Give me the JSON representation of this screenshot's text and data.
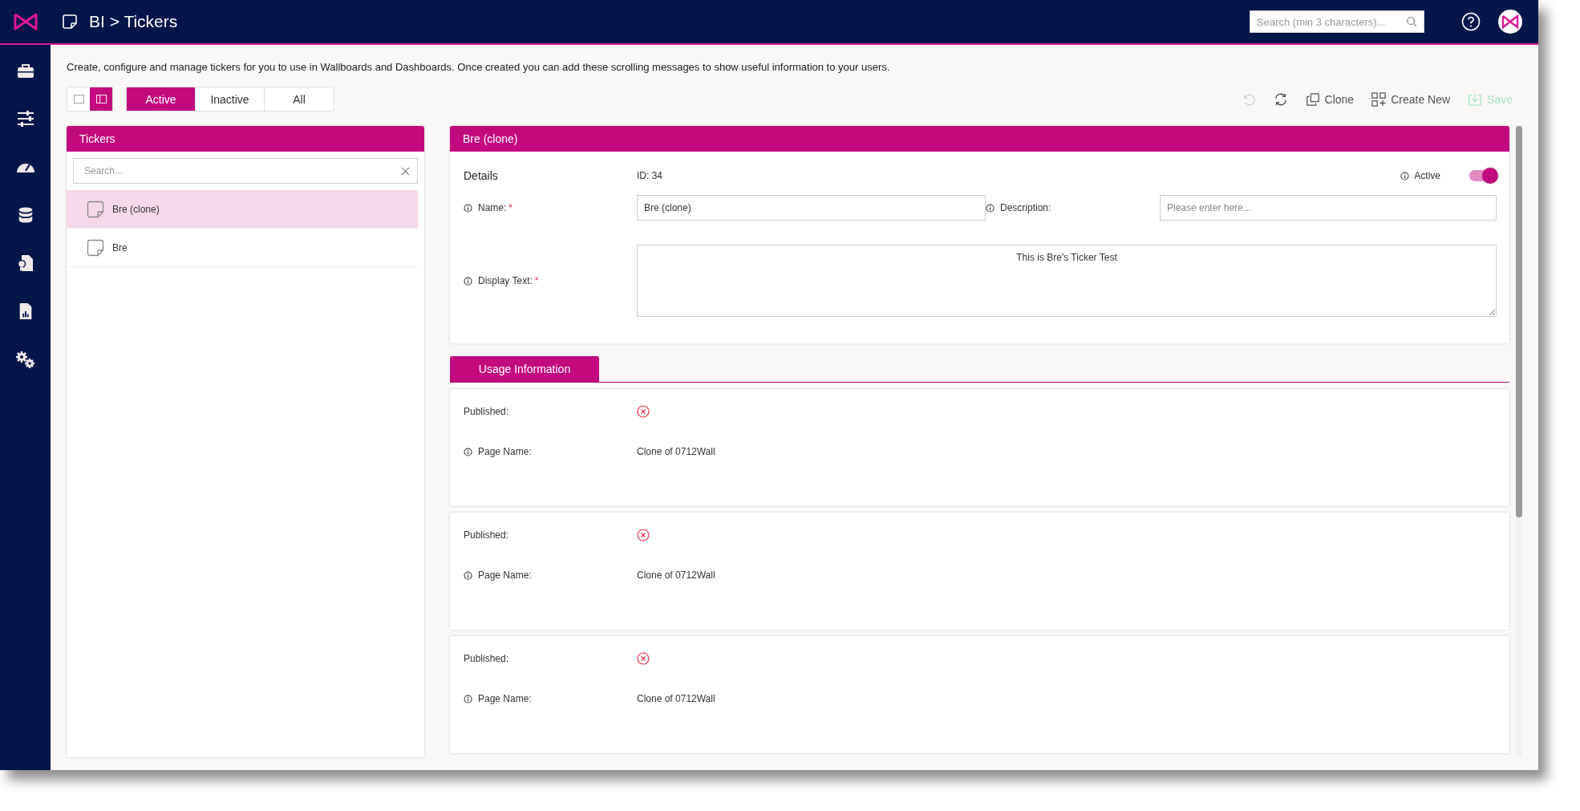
{
  "header": {
    "title": "BI > Tickers",
    "search_placeholder": "Search (min 3 characters)..."
  },
  "intro": "Create, configure and manage tickers for you to use in Wallboards and Dashboards. Once created you can add these scrolling messages to show useful information to your users.",
  "view_toggle": [
    {
      "kind": "single",
      "selected": false
    },
    {
      "kind": "split",
      "selected": true
    }
  ],
  "filter_tabs": [
    {
      "label": "Active",
      "selected": true
    },
    {
      "label": "Inactive",
      "selected": false
    },
    {
      "label": "All",
      "selected": false
    }
  ],
  "toolbar": [
    {
      "kind": "undo",
      "disabled": true
    },
    {
      "kind": "refresh",
      "disabled": false
    },
    {
      "kind": "clone",
      "label": "Clone",
      "disabled": false
    },
    {
      "kind": "create",
      "label": "Create New",
      "disabled": false
    },
    {
      "kind": "save",
      "label": "Save",
      "disabled": true
    }
  ],
  "tickers_panel": {
    "title": "Tickers",
    "search_placeholder": "Search...",
    "items": [
      {
        "name": "Bre (clone)",
        "selected": true
      },
      {
        "name": "Bre",
        "selected": false
      }
    ]
  },
  "details": {
    "title": "Bre (clone)",
    "section": "Details",
    "id": "ID: 34",
    "active_label": "Active",
    "active": true,
    "name": {
      "label": "Name:",
      "required_mark": "*",
      "value": "Bre (clone)"
    },
    "description": {
      "label": "Description:",
      "placeholder": "Please enter here..."
    },
    "display_text": {
      "label": "Display Text:",
      "required_mark": "*",
      "value": "This is Bre's Ticker Test"
    }
  },
  "usage": {
    "tab": "Usage Information",
    "entries": [
      {
        "published_label": "Published:",
        "published": false,
        "page_label": "Page Name:",
        "page_name": "Clone of 0712Wall"
      },
      {
        "published_label": "Published:",
        "published": false,
        "page_label": "Page Name:",
        "page_name": "Clone of 0712Wall"
      },
      {
        "published_label": "Published:",
        "published": false,
        "page_label": "Page Name:",
        "page_name": "Clone of 0712Wall"
      }
    ]
  }
}
